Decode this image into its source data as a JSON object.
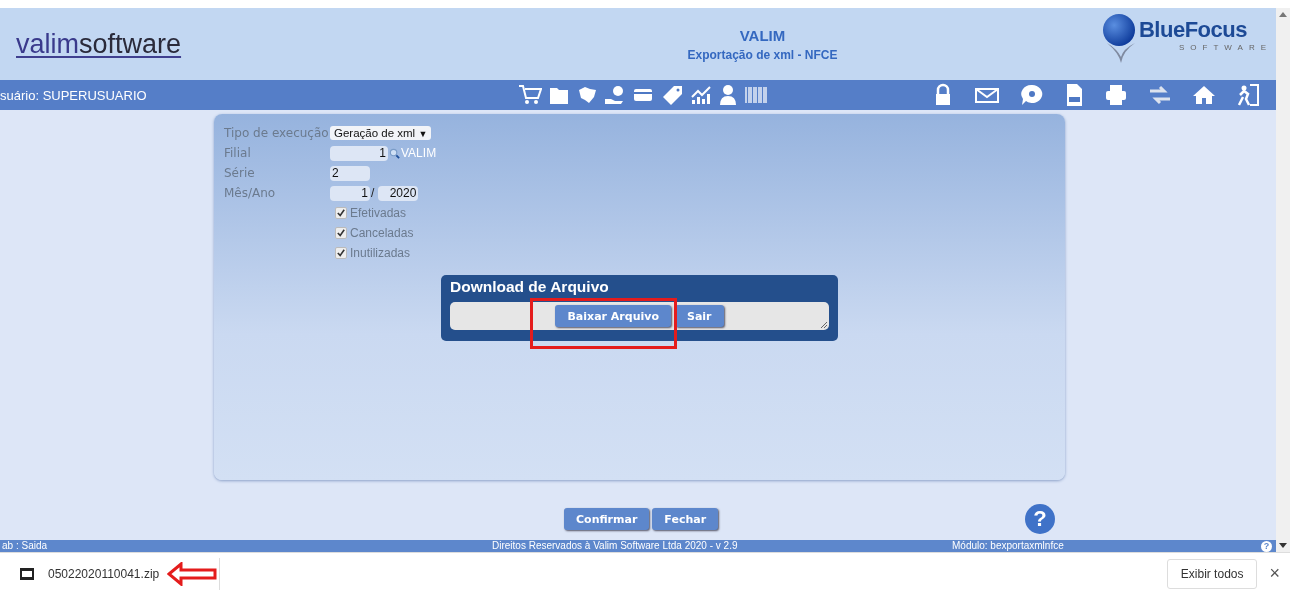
{
  "header": {
    "logo": {
      "first": "valim",
      "second": "software"
    },
    "title": "VALIM",
    "subtitle": "Exportação de xml - NFCE",
    "brand": {
      "word1": "Blue",
      "word2": "Focus",
      "tagline": "SOFTWARE"
    }
  },
  "nav": {
    "user": "suário: SUPERUSUARIO"
  },
  "form": {
    "fields": [
      {
        "kind": "select",
        "label": "Tipo de execução",
        "value": "Geração de xml",
        "arrow": "▼"
      },
      {
        "kind": "lookup",
        "label": "Filial",
        "value": "1",
        "extra": "VALIM"
      },
      {
        "kind": "text",
        "label": "Série",
        "value": "2"
      },
      {
        "kind": "period",
        "label": "Mês/Ano",
        "value": "1",
        "separator": "/",
        "value2": "2020"
      }
    ],
    "checkboxes": [
      {
        "label": "Efetivadas",
        "checked": true
      },
      {
        "label": "Canceladas",
        "checked": true
      },
      {
        "label": "Inutilizadas",
        "checked": true
      }
    ]
  },
  "dialog": {
    "title": "Download de Arquivo",
    "buttons": [
      "Baixar Arquivo",
      "Sair"
    ]
  },
  "footer": {
    "buttons": [
      "Confirmar",
      "Fechar"
    ],
    "help": "?"
  },
  "status_bar": {
    "left": "ab : Saida",
    "center": "Direitos Reservados à Valim Software Ltda 2020 - v 2.9",
    "right": "Módulo: bexportaxmlnfce",
    "help": "?"
  },
  "download_bar": {
    "file": "05022020110041.zip",
    "show_all": "Exibir todos",
    "close": "×"
  }
}
